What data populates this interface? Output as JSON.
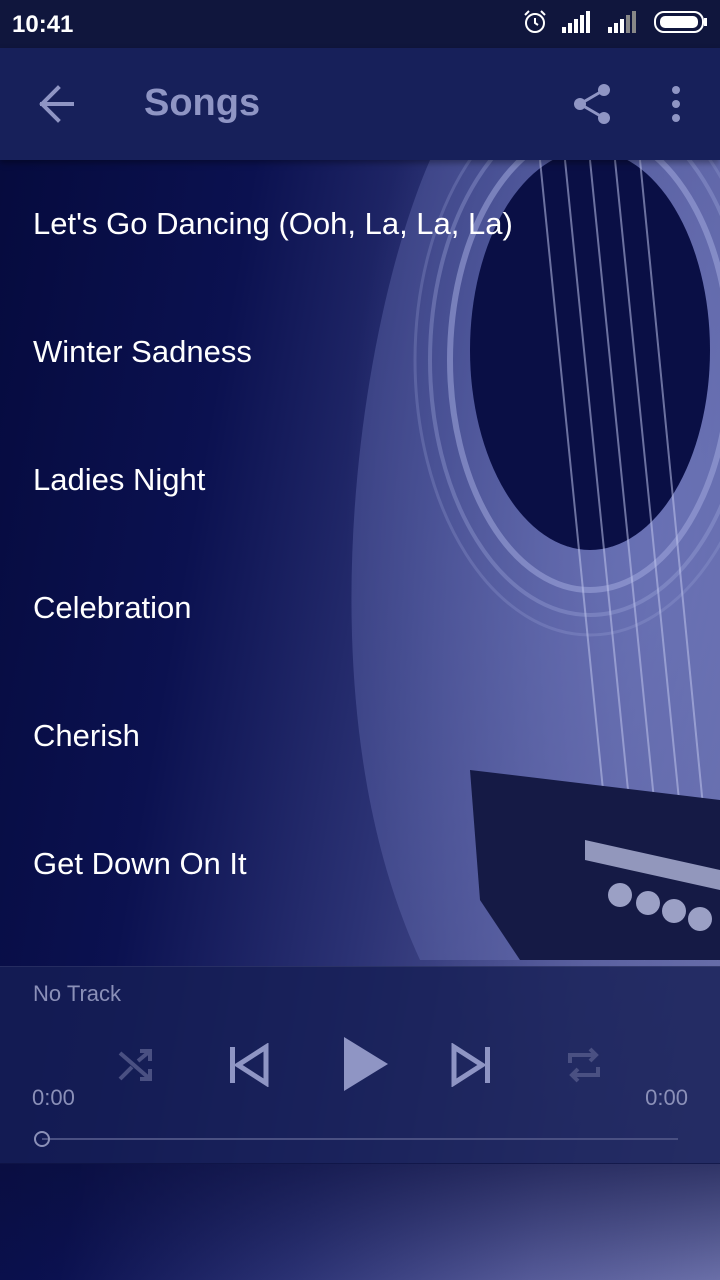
{
  "status_bar": {
    "time": "10:41"
  },
  "app_bar": {
    "title": "Songs"
  },
  "songs": [
    {
      "title": "Let's Go Dancing (Ooh, La, La, La)"
    },
    {
      "title": "Winter Sadness"
    },
    {
      "title": "Ladies Night"
    },
    {
      "title": "Celebration"
    },
    {
      "title": "Cherish"
    },
    {
      "title": "Get Down On It"
    }
  ],
  "player": {
    "track_name": "No Track",
    "elapsed": "0:00",
    "duration": "0:00",
    "progress": 0
  },
  "icons": {
    "back": "arrow-back-icon",
    "share": "share-icon",
    "more": "more-vert-icon",
    "shuffle": "shuffle-icon",
    "previous": "skip-previous-icon",
    "play": "play-icon",
    "next": "skip-next-icon",
    "repeat": "repeat-icon",
    "alarm": "alarm-icon",
    "signal": "signal-icon",
    "battery": "battery-icon"
  },
  "colors": {
    "app_bar": "#17205a",
    "status_bar": "#10163d",
    "muted_text": "#8b90b8"
  }
}
